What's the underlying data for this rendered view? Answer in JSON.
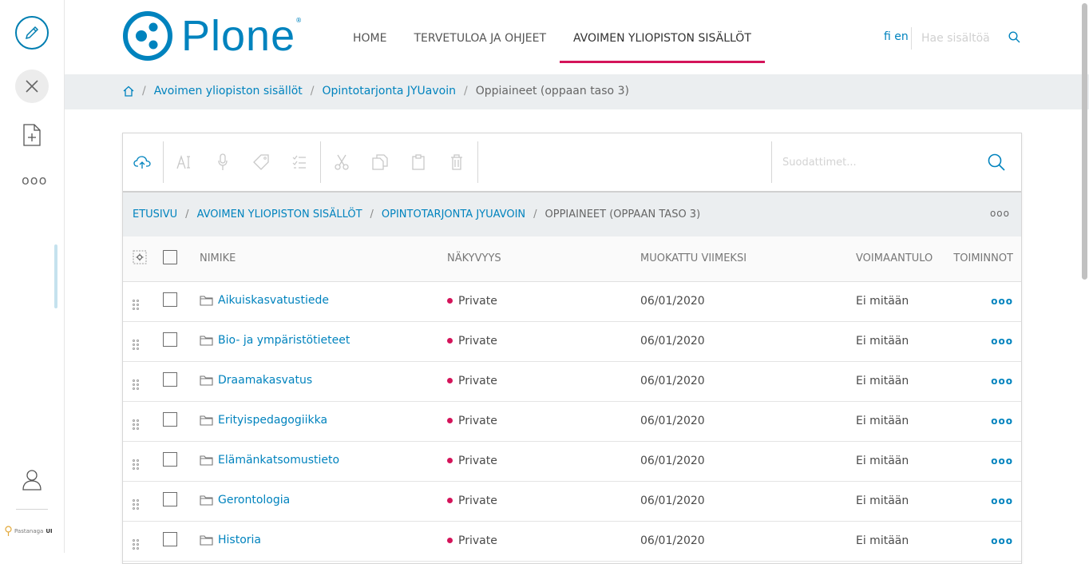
{
  "toolbar": {
    "more_label": "ooo",
    "brand_prefix": "Pastanaga",
    "brand_suffix": "UI"
  },
  "header": {
    "logo_text": "Plone",
    "logo_reg": "®",
    "nav": [
      "HOME",
      "TERVETULOA JA OHJEET",
      "AVOIMEN YLIOPISTON SISÄLLÖT"
    ],
    "lang_fi": "fi",
    "lang_en": "en",
    "search_placeholder": "Hae sisältöä"
  },
  "breadcrumb": {
    "items": [
      "Avoimen yliopiston sisällöt",
      "Opintotarjonta JYUavoin"
    ],
    "current": "Oppiaineet (oppaan taso 3)"
  },
  "contents": {
    "filter_placeholder": "Suodattimet...",
    "crumbs": [
      "ETUSIVU",
      "AVOIMEN YLIOPISTON SISÄLLÖT",
      "OPINTOTARJONTA JYUAVOIN"
    ],
    "crumbs_current": "OPPIAINEET (OPPAAN TASO 3)",
    "columns": {
      "title": "NIMIKE",
      "visibility": "NÄKYVYYS",
      "modified": "MUOKATTU VIIMEKSI",
      "effective": "VOIMAANTULO",
      "actions": "TOIMINNOT"
    },
    "rows": [
      {
        "title": "Aikuiskasvatustiede",
        "visibility": "Private",
        "modified": "06/01/2020",
        "effective": "Ei mitään"
      },
      {
        "title": "Bio- ja ympäristötieteet",
        "visibility": "Private",
        "modified": "06/01/2020",
        "effective": "Ei mitään"
      },
      {
        "title": "Draamakasvatus",
        "visibility": "Private",
        "modified": "06/01/2020",
        "effective": "Ei mitään"
      },
      {
        "title": "Erityispedagogiikka",
        "visibility": "Private",
        "modified": "06/01/2020",
        "effective": "Ei mitään"
      },
      {
        "title": "Elämänkatsomustieto",
        "visibility": "Private",
        "modified": "06/01/2020",
        "effective": "Ei mitään"
      },
      {
        "title": "Gerontologia",
        "visibility": "Private",
        "modified": "06/01/2020",
        "effective": "Ei mitään"
      },
      {
        "title": "Historia",
        "visibility": "Private",
        "modified": "06/01/2020",
        "effective": "Ei mitään"
      }
    ],
    "row_actions_label": "ooo",
    "crumbs_more_label": "ooo"
  },
  "colors": {
    "accent": "#0083be",
    "active_underline": "#d4145a",
    "private_dot": "#d4145a"
  }
}
